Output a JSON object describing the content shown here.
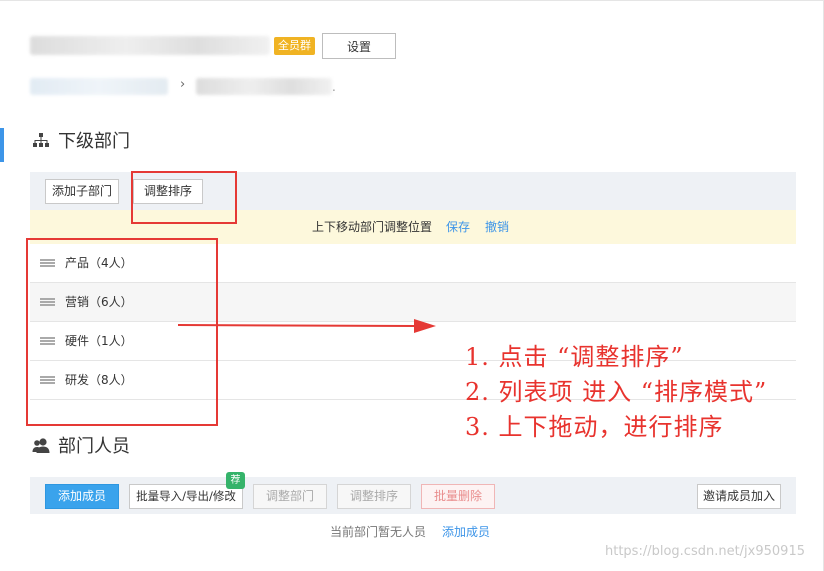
{
  "header": {
    "badge": "全员群",
    "settings_label": "设置",
    "breadcrumb_sep": "›",
    "breadcrumb_tail": "."
  },
  "sub_departments": {
    "title": "下级部门",
    "add_sub_label": "添加子部门",
    "adjust_order_label": "调整排序",
    "notice": {
      "text": "上下移动部门调整位置",
      "save": "保存",
      "undo": "撤销"
    },
    "items": [
      {
        "label": "产品（4人）"
      },
      {
        "label": "营销（6人）"
      },
      {
        "label": "硬件（1人）"
      },
      {
        "label": "研发（8人）"
      }
    ]
  },
  "members": {
    "title": "部门人员",
    "add_member_label": "添加成员",
    "batch_import_label": "批量导入/导出/修改",
    "recommend_badge": "荐",
    "adjust_dept_label": "调整部门",
    "adjust_order_label": "调整排序",
    "batch_delete_label": "批量删除",
    "invite_label": "邀请成员加入",
    "empty_tip": "当前部门暂无人员",
    "empty_add": "添加成员"
  },
  "annotation": {
    "lines": [
      "1.  点击 “调整排序”",
      "2.  列表项 进入 “排序模式”",
      "3.  上下拖动，进行排序"
    ],
    "color": "#e8332e"
  },
  "watermark": "https://blog.csdn.net/jx950915"
}
